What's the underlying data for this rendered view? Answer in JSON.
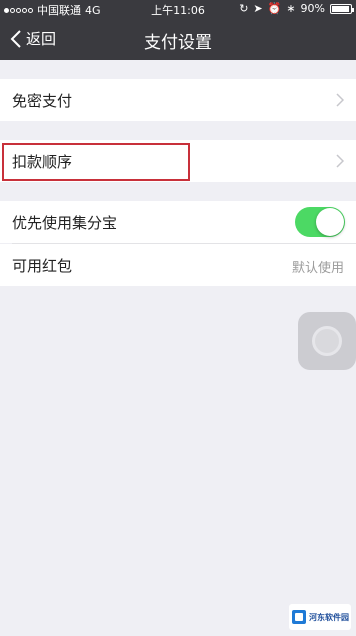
{
  "status_bar": {
    "carrier": "中国联通",
    "network": "4G",
    "time": "上午11:06",
    "battery": "90%"
  },
  "nav": {
    "back_label": "返回",
    "title": "支付设置"
  },
  "rows": {
    "free_pay": {
      "label": "免密支付"
    },
    "deduction_order": {
      "label": "扣款顺序"
    },
    "prefer_jifenbao": {
      "label": "优先使用集分宝",
      "enabled": true
    },
    "red_packet": {
      "label": "可用红包",
      "value": "默认使用"
    }
  },
  "colors": {
    "nav_bg": "#3a3a3f",
    "toggle_on": "#4cd964",
    "highlight_border": "#c8303a",
    "page_bg": "#efeff4"
  },
  "watermark": {
    "text": "河东软件园"
  }
}
